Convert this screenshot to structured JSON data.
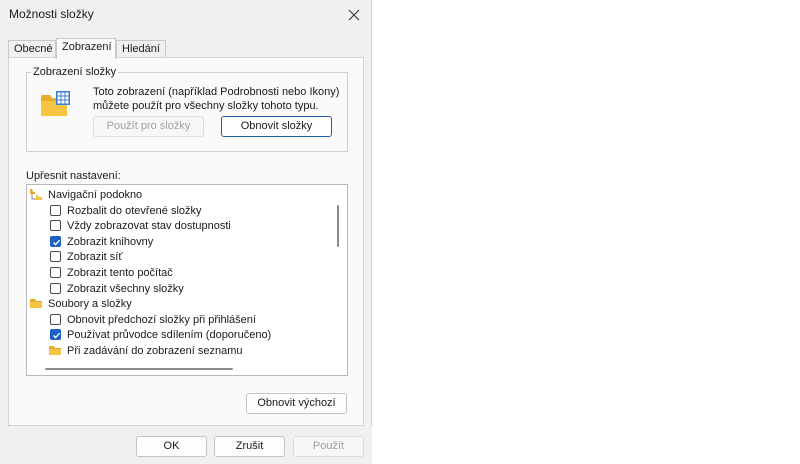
{
  "window": {
    "title": "Možnosti složky"
  },
  "tabs": [
    {
      "label": "Obecné"
    },
    {
      "label": "Zobrazení"
    },
    {
      "label": "Hledání"
    }
  ],
  "folder_views": {
    "group_label": "Zobrazení složky",
    "description_line1": "Toto zobrazení (například Podrobnosti nebo Ikony)",
    "description_line2": "můžete použít pro všechny složky tohoto typu.",
    "apply_button": "Použít pro složky",
    "reset_button": "Obnovit složky"
  },
  "advanced": {
    "label": "Upřesnit nastavení:",
    "items": [
      {
        "type": "group",
        "label": "Navigační podokno",
        "icon": "navigation-pane-icon"
      },
      {
        "type": "checkbox",
        "label": "Rozbalit do otevřené složky",
        "checked": false
      },
      {
        "type": "checkbox",
        "label": "Vždy zobrazovat stav dostupnosti",
        "checked": false
      },
      {
        "type": "checkbox",
        "label": "Zobrazit knihovny",
        "checked": true
      },
      {
        "type": "checkbox",
        "label": "Zobrazit síť",
        "checked": false
      },
      {
        "type": "checkbox",
        "label": "Zobrazit tento počítač",
        "checked": false
      },
      {
        "type": "checkbox",
        "label": "Zobrazit všechny složky",
        "checked": false
      },
      {
        "type": "group",
        "label": "Soubory a složky",
        "icon": "folder-icon"
      },
      {
        "type": "checkbox",
        "label": "Obnovit předchozí složky při přihlášení",
        "checked": false
      },
      {
        "type": "checkbox",
        "label": "Používat průvodce sdílením (doporučeno)",
        "checked": true
      },
      {
        "type": "subgroup",
        "label": "Při zadávání do zobrazení seznamu",
        "icon": "folder-icon"
      }
    ],
    "restore_defaults_button": "Obnovit výchozí"
  },
  "footer": {
    "ok": "OK",
    "cancel": "Zrušit",
    "apply": "Použít"
  },
  "colors": {
    "accent": "#1e5fc4",
    "folder": "#f5c542",
    "dialog_bg": "#f0f0f0"
  }
}
